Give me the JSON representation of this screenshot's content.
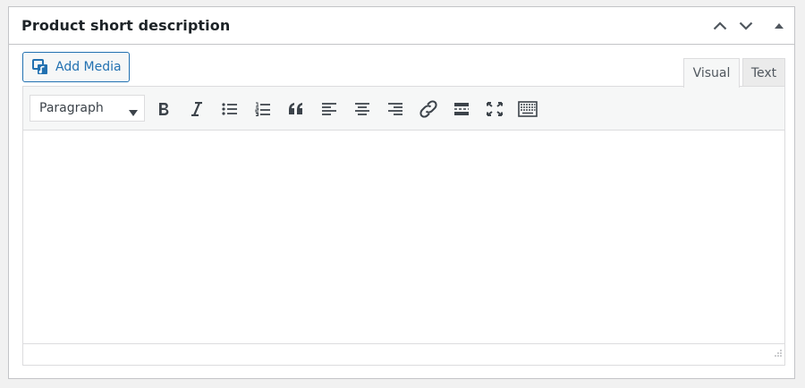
{
  "box": {
    "title": "Product short description",
    "icons": [
      "chevron-up-icon",
      "chevron-down-icon",
      "triangle-up-icon"
    ]
  },
  "media": {
    "add_media_label": "Add Media",
    "icon": "add-media-icon"
  },
  "tabs": [
    {
      "label": "Visual",
      "active": true
    },
    {
      "label": "Text",
      "active": false
    }
  ],
  "toolbar": {
    "format_value": "Paragraph",
    "buttons": [
      "bold-icon",
      "italic-icon",
      "bulleted-list-icon",
      "numbered-list-icon",
      "blockquote-icon",
      "align-left-icon",
      "align-center-icon",
      "align-right-icon",
      "link-icon",
      "read-more-icon",
      "fullscreen-icon",
      "toolbar-toggle-icon"
    ]
  },
  "colors": {
    "accent": "#2271b1",
    "border": "#c3c4c7",
    "toolbar_bg": "#f6f7f7",
    "page_bg": "#f1f1f1"
  }
}
